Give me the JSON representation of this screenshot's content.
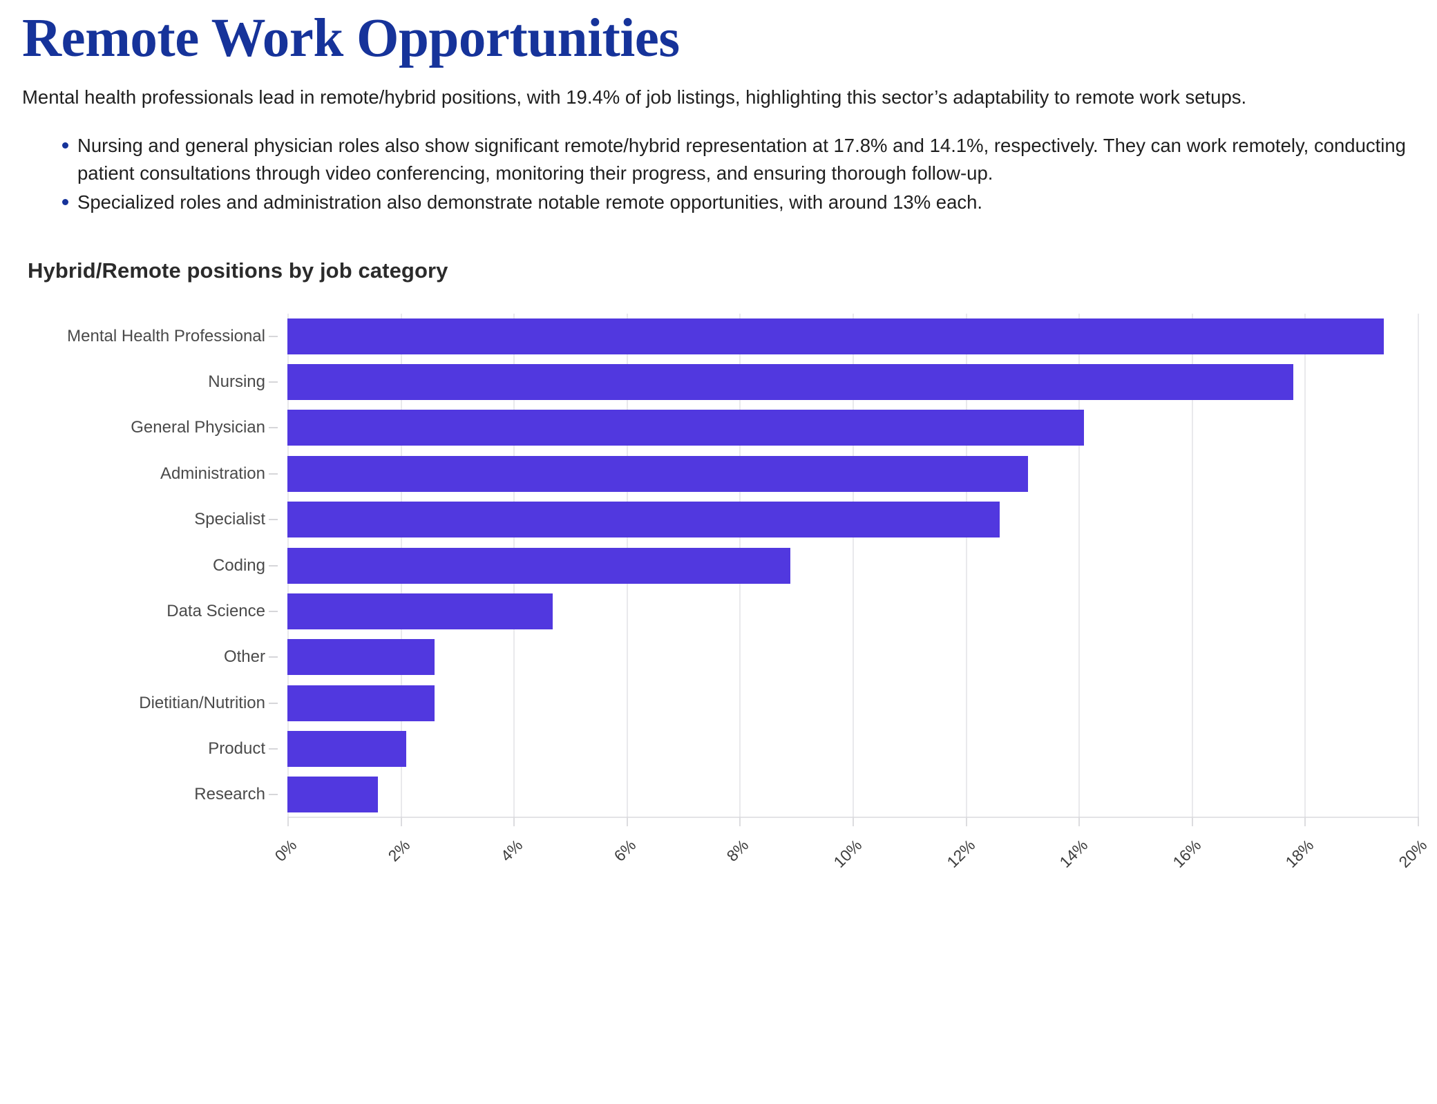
{
  "header": {
    "title": "Remote Work Opportunities",
    "lede": "Mental health professionals lead in remote/hybrid positions, with 19.4% of job listings, highlighting this sector’s adaptability to remote work setups."
  },
  "bullets": [
    "Nursing and general physician roles also show significant remote/hybrid representation at 17.8% and 14.1%, respectively. They can work remotely, conducting patient consultations through video conferencing, monitoring their progress, and ensuring thorough follow-up.",
    "Specialized roles and administration also demonstrate notable remote opportunities, with around 13% each."
  ],
  "colors": {
    "title_blue": "#16339a",
    "bar_purple": "#5138df",
    "bullet_blue": "#16339a",
    "gridline": "#e9e9ec",
    "label_gray": "#4a4a4a"
  },
  "chart_data": {
    "type": "bar",
    "orientation": "horizontal",
    "title": "Hybrid/Remote positions by job category",
    "xlabel": "",
    "ylabel": "",
    "xlim": [
      0,
      20
    ],
    "grid": true,
    "legend": false,
    "xtick_labels": [
      "0%",
      "2%",
      "4%",
      "6%",
      "8%",
      "10%",
      "12%",
      "14%",
      "16%",
      "18%",
      "20%"
    ],
    "xtick_values": [
      0,
      2,
      4,
      6,
      8,
      10,
      12,
      14,
      16,
      18,
      20
    ],
    "categories": [
      "Mental Health Professional",
      "Nursing",
      "General Physician",
      "Administration",
      "Specialist",
      "Coding",
      "Data Science",
      "Other",
      "Dietitian/Nutrition",
      "Product",
      "Research"
    ],
    "values": [
      19.4,
      17.8,
      14.1,
      13.1,
      12.6,
      8.9,
      4.7,
      2.6,
      2.6,
      2.1,
      1.6
    ],
    "value_unit": "%",
    "series_color": "#5138df"
  }
}
